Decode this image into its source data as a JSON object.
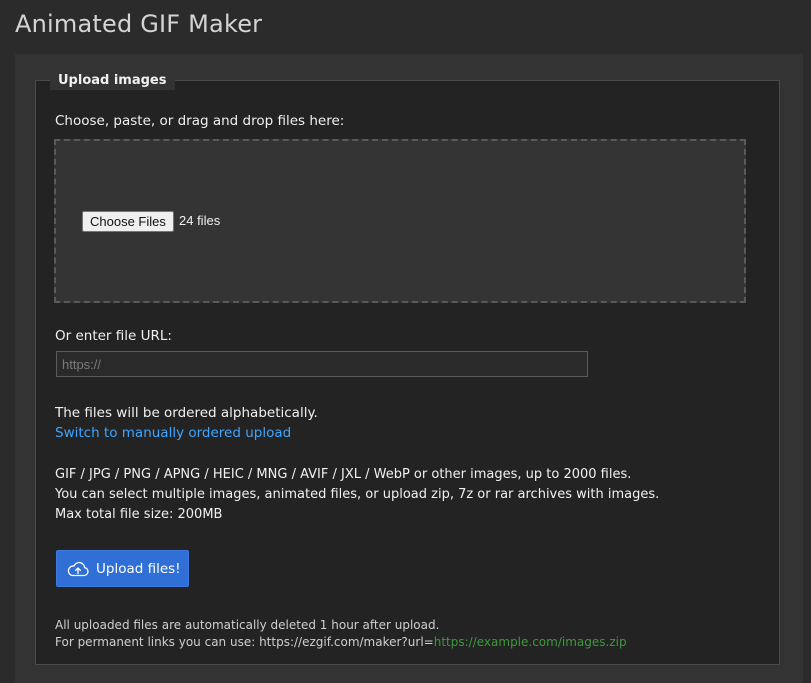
{
  "page": {
    "title": "Animated GIF Maker"
  },
  "upload": {
    "legend": "Upload images",
    "choose_label": "Choose, paste, or drag and drop files here:",
    "choose_button": "Choose Files",
    "file_count": "24 files",
    "url_label": "Or enter file URL:",
    "url_placeholder": "https://",
    "url_value": "",
    "order_note": "The files will be ordered alphabetically.",
    "order_link": "Switch to manually ordered upload",
    "formats_line": "GIF / JPG / PNG / APNG / HEIC / MNG / AVIF / JXL / WebP or other images, up to 2000 files.",
    "multi_line": "You can select multiple images, animated files, or upload zip, 7z or rar archives with images.",
    "max_size_line": "Max total file size: 200MB",
    "upload_button": "Upload files!",
    "upload_button_icon": "cloud-upload-icon",
    "auto_delete_note": "All uploaded files are automatically deleted 1 hour after upload.",
    "permalink_prefix": "For permanent links you can use: https://ezgif.com/maker?url=",
    "permalink_example": "https://example.com/images.zip"
  },
  "colors": {
    "background": "#2b2b2b",
    "panel": "#333333",
    "fieldset": "#232323",
    "link": "#3ea6ff",
    "upload_button": "#2f6fd6",
    "example_link": "#3c9a3c"
  }
}
